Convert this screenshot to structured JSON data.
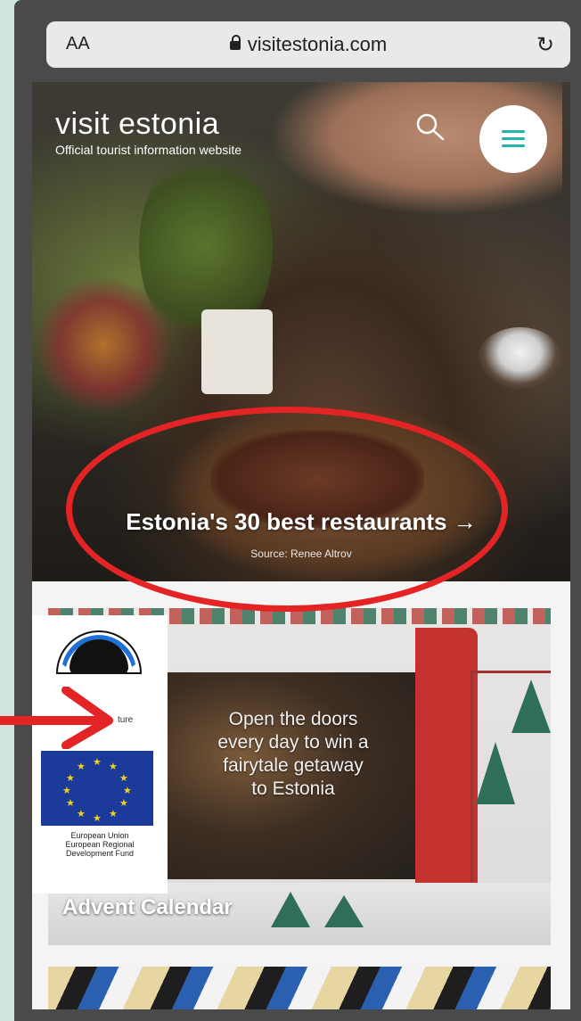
{
  "browser": {
    "text_size_label": "AA",
    "url": "visitestonia.com",
    "reload_icon": "reload-icon"
  },
  "hero": {
    "brand_name": "visit estonia",
    "brand_subtitle": "Official tourist information website",
    "headline": "Estonia's 30 best restaurants →",
    "credit": "Source: Renee Altrov",
    "icons": [
      "search-icon",
      "menu-icon"
    ],
    "accent_color": "#23b3aa"
  },
  "advent_card": {
    "text_lines": [
      "Open the doors",
      "every day to win a",
      "fairytale getaway",
      "to Estonia"
    ],
    "label": "Advent Calendar"
  },
  "eu_badge": {
    "logo_caption": "ture",
    "text_lines": [
      "European Union",
      "European Regional",
      "Development Fund"
    ]
  },
  "annotations": {
    "highlight_color": "#e42424"
  }
}
